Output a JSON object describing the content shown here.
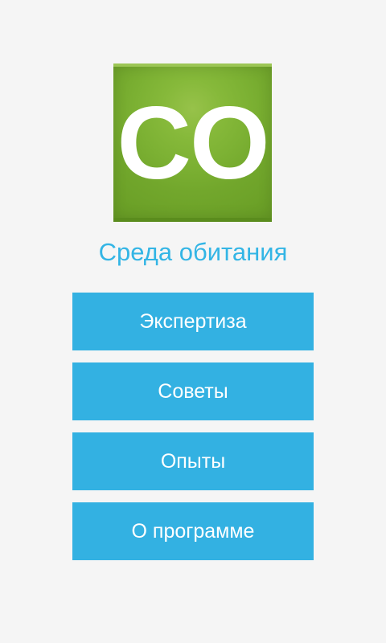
{
  "logo": {
    "text": "CO",
    "colors": {
      "background": "#7cb133",
      "text": "#ffffff"
    }
  },
  "app": {
    "title": "Среда обитания",
    "title_color": "#33b5e5"
  },
  "menu": {
    "button_color": "#33b1e2",
    "items": [
      {
        "label": "Экспертиза"
      },
      {
        "label": "Советы"
      },
      {
        "label": "Опыты"
      },
      {
        "label": "О программе"
      }
    ]
  }
}
